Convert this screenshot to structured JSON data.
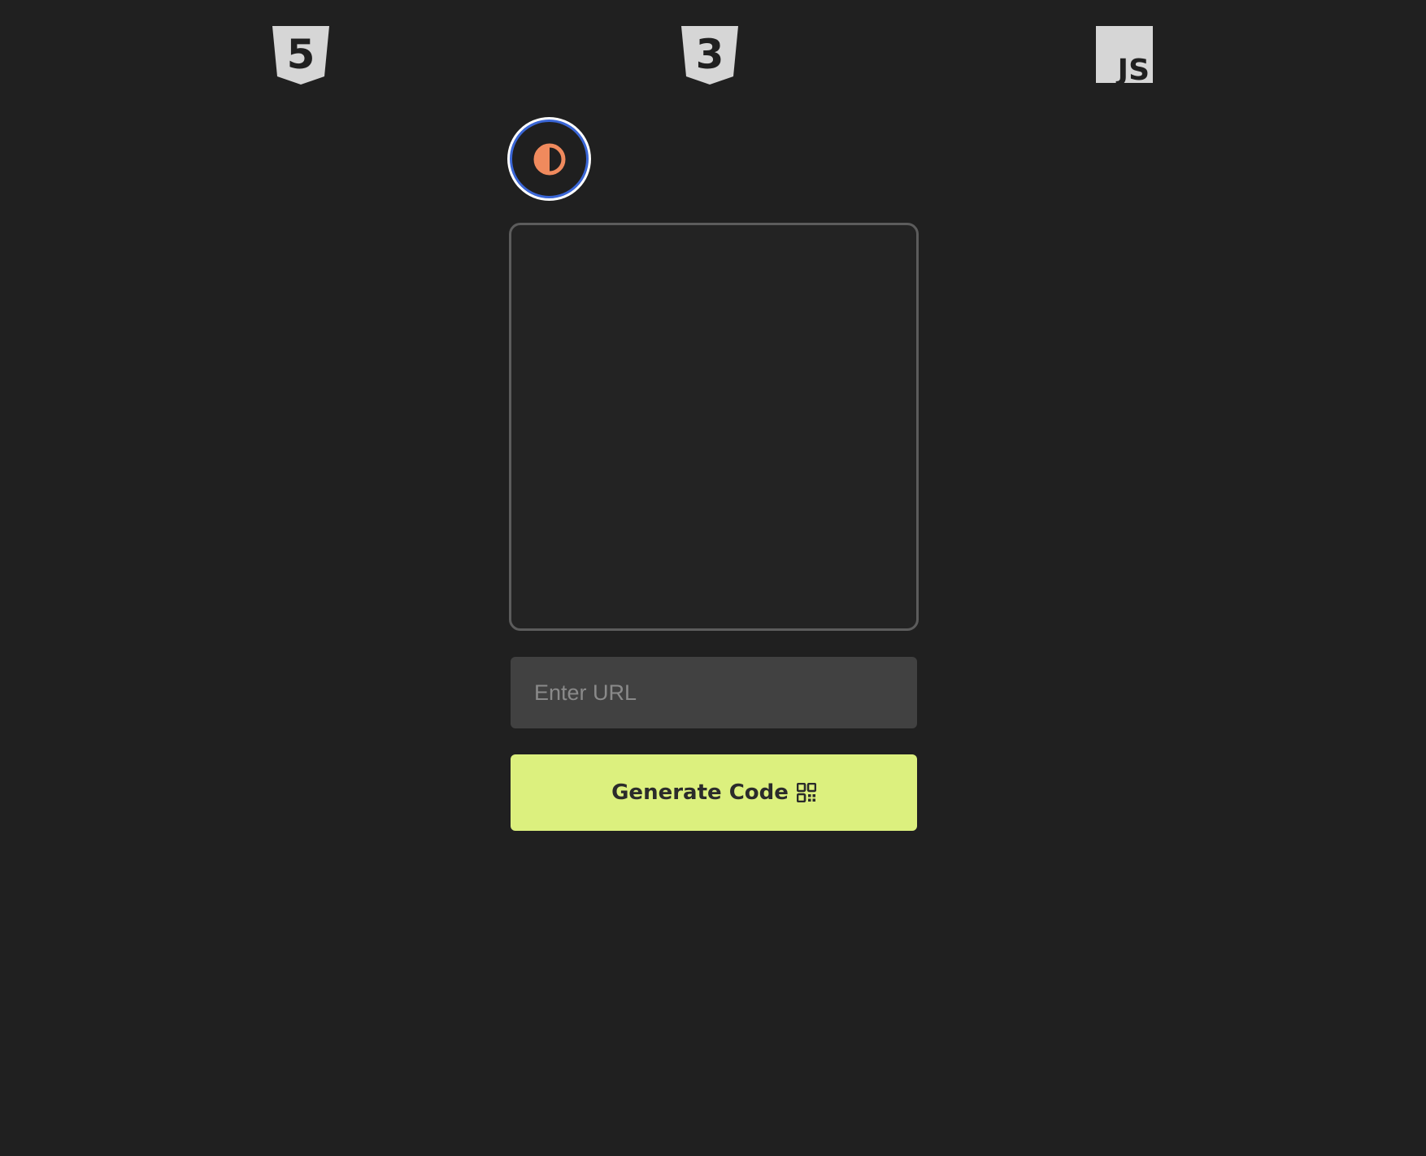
{
  "header": {
    "icons": [
      {
        "name": "html5-icon",
        "label": "5"
      },
      {
        "name": "css3-icon",
        "label": "3"
      },
      {
        "name": "javascript-icon",
        "label": "JS"
      }
    ]
  },
  "theme_toggle": {
    "icon": "contrast-icon",
    "accent_color": "#f08a5d",
    "ring_color": "#3a66d6"
  },
  "qr_preview": {
    "border_color": "#5c5c5c"
  },
  "url_input": {
    "placeholder": "Enter URL",
    "value": ""
  },
  "generate_button": {
    "label": "Generate Code",
    "icon": "qr-code-icon",
    "background": "#dcf07e"
  },
  "colors": {
    "background": "#202020",
    "icon_gray": "#d6d6d6"
  }
}
